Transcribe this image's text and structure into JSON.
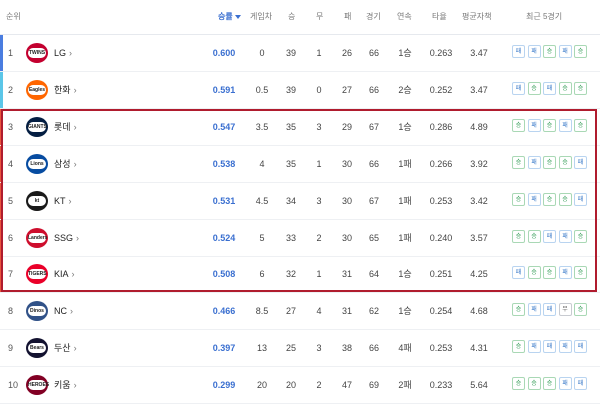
{
  "header": {
    "rank": "순위",
    "pct": "승률",
    "gb": "게임차",
    "w": "승",
    "d": "무",
    "l": "패",
    "g": "경기",
    "streak": "연속",
    "avg": "타율",
    "era": "평균자책",
    "recent": "최근 5경기"
  },
  "colors": {
    "accent": "#3a6fd0",
    "highlight_border": "#b01c2e",
    "rank1_bar": "#4a7de0",
    "rank2_bar": "#5bc6e8",
    "rank3_7_bar": "#e8553d",
    "win_badge": "#2e9a52",
    "loss_badge": "#3a7ac9"
  },
  "teams": [
    {
      "rank": "1",
      "name": "LG",
      "pct": "0.600",
      "gb": "0",
      "w": "39",
      "d": "1",
      "l": "26",
      "g": "66",
      "streak": "1승",
      "avg": "0.263",
      "era": "3.47",
      "recent": [
        "패",
        "패",
        "승",
        "패",
        "승"
      ],
      "logo_text": "TWINS",
      "logo_color": "#c3002f",
      "bar": "#4a7de0"
    },
    {
      "rank": "2",
      "name": "한화",
      "pct": "0.591",
      "gb": "0.5",
      "w": "39",
      "d": "0",
      "l": "27",
      "g": "66",
      "streak": "2승",
      "avg": "0.252",
      "era": "3.47",
      "recent": [
        "패",
        "승",
        "패",
        "승",
        "승"
      ],
      "logo_text": "Eagles",
      "logo_color": "#ff6600",
      "bar": "#5bc6e8"
    },
    {
      "rank": "3",
      "name": "롯데",
      "pct": "0.547",
      "gb": "3.5",
      "w": "35",
      "d": "3",
      "l": "29",
      "g": "67",
      "streak": "1승",
      "avg": "0.286",
      "era": "4.89",
      "recent": [
        "승",
        "패",
        "승",
        "패",
        "승"
      ],
      "logo_text": "GIANTS",
      "logo_color": "#041e42",
      "bar": "#e8553d"
    },
    {
      "rank": "4",
      "name": "삼성",
      "pct": "0.538",
      "gb": "4",
      "w": "35",
      "d": "1",
      "l": "30",
      "g": "66",
      "streak": "1패",
      "avg": "0.266",
      "era": "3.92",
      "recent": [
        "승",
        "패",
        "승",
        "승",
        "패"
      ],
      "logo_text": "Lions",
      "logo_color": "#074ca1",
      "bar": "#e8553d"
    },
    {
      "rank": "5",
      "name": "KT",
      "pct": "0.531",
      "gb": "4.5",
      "w": "34",
      "d": "3",
      "l": "30",
      "g": "67",
      "streak": "1패",
      "avg": "0.253",
      "era": "3.42",
      "recent": [
        "승",
        "패",
        "승",
        "승",
        "패"
      ],
      "logo_text": "kt",
      "logo_color": "#1a1a1a",
      "bar": "#e8553d"
    },
    {
      "rank": "6",
      "name": "SSG",
      "pct": "0.524",
      "gb": "5",
      "w": "33",
      "d": "2",
      "l": "30",
      "g": "65",
      "streak": "1패",
      "avg": "0.240",
      "era": "3.57",
      "recent": [
        "승",
        "승",
        "패",
        "패",
        "승"
      ],
      "logo_text": "Landers",
      "logo_color": "#ce0e2d",
      "bar": "#e8553d"
    },
    {
      "rank": "7",
      "name": "KIA",
      "pct": "0.508",
      "gb": "6",
      "w": "32",
      "d": "1",
      "l": "31",
      "g": "64",
      "streak": "1승",
      "avg": "0.251",
      "era": "4.25",
      "recent": [
        "패",
        "승",
        "승",
        "패",
        "승"
      ],
      "logo_text": "TIGERS",
      "logo_color": "#ea0029",
      "bar": "#e8553d"
    },
    {
      "rank": "8",
      "name": "NC",
      "pct": "0.466",
      "gb": "8.5",
      "w": "27",
      "d": "4",
      "l": "31",
      "g": "62",
      "streak": "1승",
      "avg": "0.254",
      "era": "4.68",
      "recent": [
        "승",
        "패",
        "패",
        "무",
        "승"
      ],
      "logo_text": "Dinos",
      "logo_color": "#315288",
      "bar": ""
    },
    {
      "rank": "9",
      "name": "두산",
      "pct": "0.397",
      "gb": "13",
      "w": "25",
      "d": "3",
      "l": "38",
      "g": "66",
      "streak": "4패",
      "avg": "0.253",
      "era": "4.31",
      "recent": [
        "승",
        "패",
        "패",
        "패",
        "패"
      ],
      "logo_text": "Bears",
      "logo_color": "#131230",
      "bar": ""
    },
    {
      "rank": "10",
      "name": "키움",
      "pct": "0.299",
      "gb": "20",
      "w": "20",
      "d": "2",
      "l": "47",
      "g": "69",
      "streak": "2패",
      "avg": "0.233",
      "era": "5.64",
      "recent": [
        "승",
        "승",
        "승",
        "패",
        "패"
      ],
      "logo_text": "HEROES",
      "logo_color": "#820024",
      "bar": ""
    }
  ]
}
